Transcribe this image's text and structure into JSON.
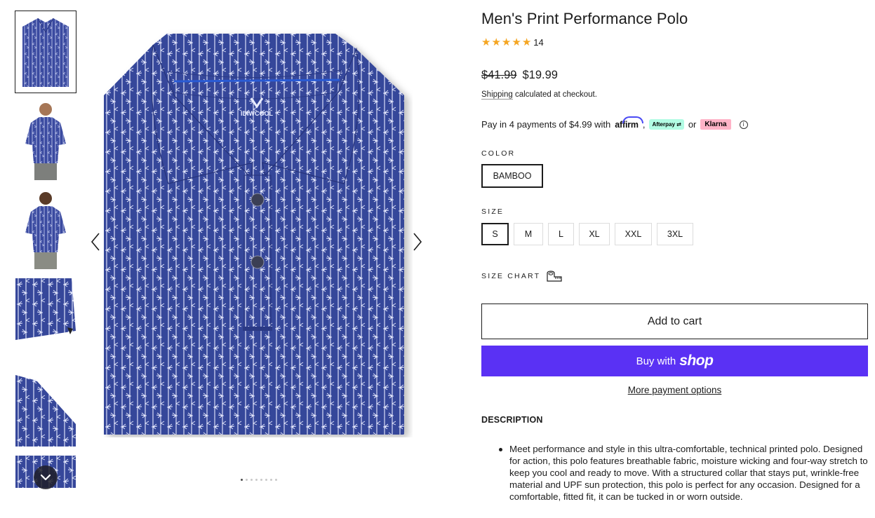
{
  "colors": {
    "shirt": "#36479a",
    "shop_button": "#5a31f4",
    "star": "#f5a623",
    "afterpay_bg": "#b2fce4",
    "klarna_bg": "#ffb3c7"
  },
  "gallery": {
    "thumbnails": [
      {
        "name": "thumb-flat-lay",
        "active": true
      },
      {
        "name": "thumb-model-front",
        "active": false
      },
      {
        "name": "thumb-model-back",
        "active": false
      },
      {
        "name": "thumb-fabric-detail",
        "active": false
      },
      {
        "name": "thumb-sleeve-detail",
        "active": false
      },
      {
        "name": "thumb-partial",
        "active": false
      }
    ],
    "scroll_down_icon": "chevron-down-icon",
    "prev_icon": "chevron-left-icon",
    "next_icon": "chevron-right-icon",
    "dot_count": 8,
    "active_dot": 0
  },
  "product": {
    "title": "Men's Print Performance Polo",
    "rating_stars": 5,
    "rating_count": "14",
    "price_old": "$41.99",
    "price_new": "$19.99",
    "shipping_link": "Shipping",
    "shipping_rest": " calculated at checkout.",
    "installments_text": "Pay in 4 payments of $4.99 with",
    "affirm": "affirm",
    "separator": ",",
    "afterpay": "Afterpay",
    "or": "or",
    "klarna": "Klarna",
    "info_icon": "info-icon"
  },
  "options": {
    "color_label": "COLOR",
    "color_selected": "BAMBOO",
    "size_label": "SIZE",
    "sizes": [
      "S",
      "M",
      "L",
      "XL",
      "XXL",
      "3XL"
    ],
    "size_selected": "S",
    "size_chart_label": "SIZE CHART",
    "size_chart_icon": "ruler-icon"
  },
  "actions": {
    "add_to_cart": "Add to cart",
    "buy_with": "Buy with",
    "shop": "shop",
    "more_payment": "More payment options"
  },
  "description": {
    "heading": "DESCRIPTION",
    "bullets": [
      "Meet performance and style in this ultra-comfortable, technical printed polo. Designed for action, this polo features breathable fabric, moisture wicking and four-way stretch to keep you cool and ready to move. With a structured collar that stays put, wrinkle-free material and UPF sun protection, this polo is perfect for any occasion. Designed for a comfortable, fitted fit, it can be tucked in or worn outside."
    ]
  }
}
